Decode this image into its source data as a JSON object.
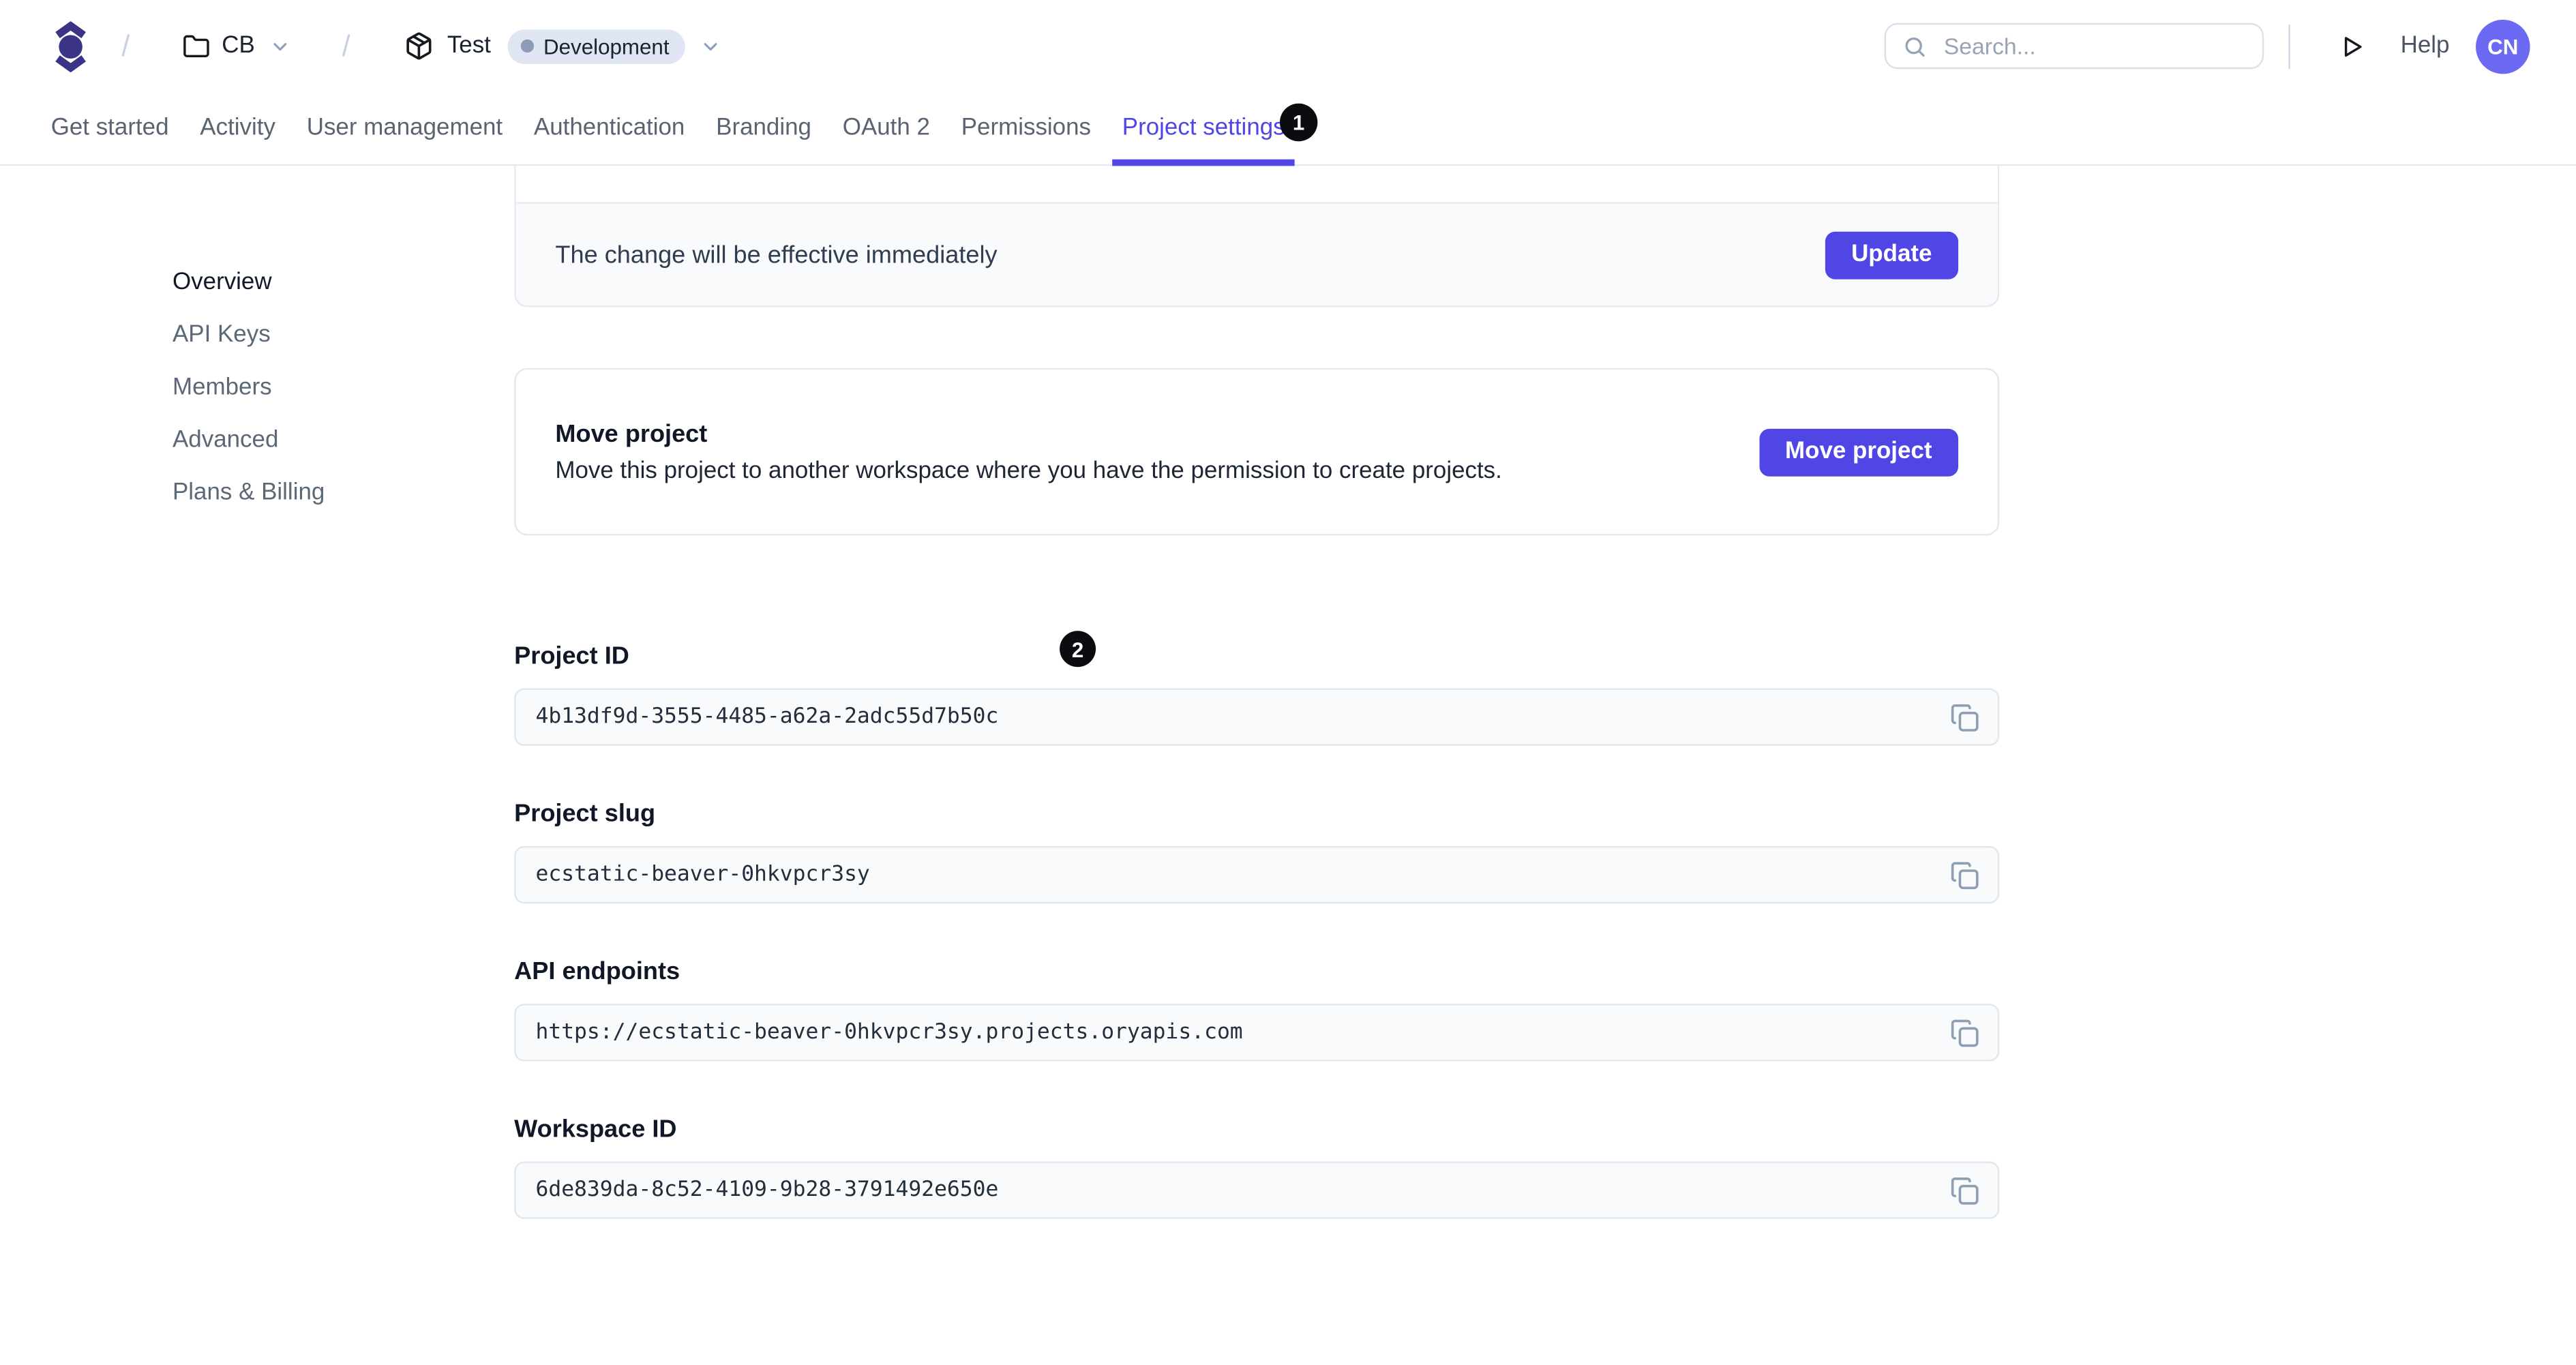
{
  "header": {
    "breadcrumb": {
      "separator": "/",
      "workspace": {
        "label": "CB"
      },
      "project": {
        "label": "Test",
        "environment": "Development"
      }
    },
    "search": {
      "placeholder": "Search..."
    },
    "help_label": "Help",
    "avatar_initials": "CN"
  },
  "tabs": [
    {
      "label": "Get started"
    },
    {
      "label": "Activity"
    },
    {
      "label": "User management"
    },
    {
      "label": "Authentication"
    },
    {
      "label": "Branding"
    },
    {
      "label": "OAuth 2"
    },
    {
      "label": "Permissions"
    },
    {
      "label": "Project settings",
      "active": true
    }
  ],
  "annotations": {
    "badge_1": "1",
    "badge_2": "2"
  },
  "sidebar": {
    "items": [
      {
        "label": "Overview",
        "active": true
      },
      {
        "label": "API Keys"
      },
      {
        "label": "Members"
      },
      {
        "label": "Advanced"
      },
      {
        "label": "Plans & Billing"
      }
    ]
  },
  "main": {
    "update_card": {
      "message": "The change will be effective immediately",
      "button_label": "Update"
    },
    "move_card": {
      "title": "Move project",
      "description": "Move this project to another workspace where you have the permission to create projects.",
      "button_label": "Move project"
    },
    "fields": [
      {
        "label": "Project ID",
        "value": "4b13df9d-3555-4485-a62a-2adc55d7b50c"
      },
      {
        "label": "Project slug",
        "value": "ecstatic-beaver-0hkvpcr3sy"
      },
      {
        "label": "API endpoints",
        "value": "https://ecstatic-beaver-0hkvpcr3sy.projects.oryapis.com"
      },
      {
        "label": "Workspace ID",
        "value": "6de839da-8c52-4109-9b28-3791492e650e"
      }
    ]
  },
  "colors": {
    "accent": "#4f46e5",
    "logo": "#3b3486",
    "avatar_bg": "#6c6af2",
    "env_badge_bg": "#dfe5f2",
    "field_bg": "#f8fafc",
    "border": "#e4e9f0",
    "annotation_bg": "#0b0c0f"
  }
}
